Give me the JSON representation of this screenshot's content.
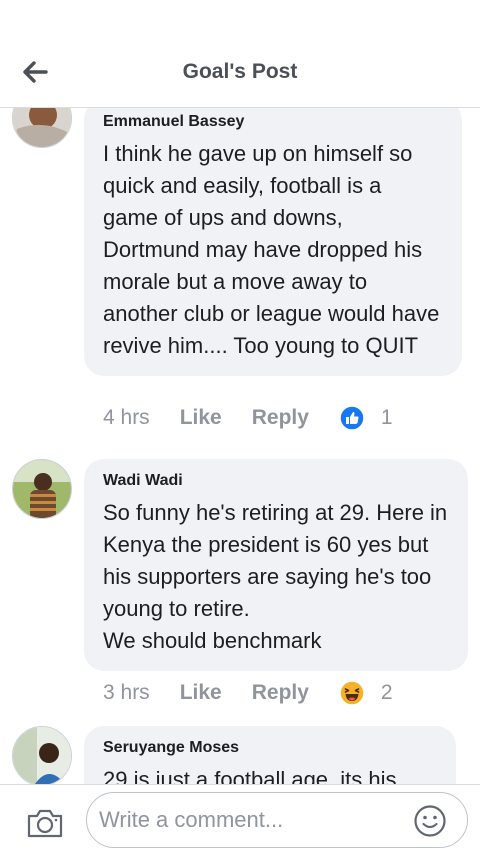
{
  "header": {
    "title": "Goal's Post",
    "back_icon": "arrow-left-icon"
  },
  "comments": [
    {
      "author": "Emmanuel Bassey",
      "text": "I think he gave up on himself so quick and easily, football is a game of ups and downs, Dortmund may have dropped his morale but a move away to another club or league would have revive him.... Too young to QUIT",
      "time": "4 hrs",
      "like_label": "Like",
      "reply_label": "Reply",
      "reaction_icon": "like-reaction-icon",
      "reaction_count": "1"
    },
    {
      "author": "Wadi Wadi",
      "text": "So funny he's retiring at 29. Here in Kenya the president is 60 yes but his supporters are saying he's too young to retire.\nWe should benchmark",
      "time": "3 hrs",
      "like_label": "Like",
      "reply_label": "Reply",
      "reaction_icon": "haha-reaction-icon",
      "reaction_count": "2"
    },
    {
      "author": "Seruyange Moses",
      "text": "29 is just a football age, its his"
    }
  ],
  "composer": {
    "placeholder": "Write a comment...",
    "camera_icon": "camera-icon",
    "emoji_icon": "smiley-icon"
  },
  "colors": {
    "bubble": "#f0f2f5",
    "muted_text": "#90949c",
    "like_blue": "#1877f2",
    "haha_yellow": "#f7b125"
  }
}
